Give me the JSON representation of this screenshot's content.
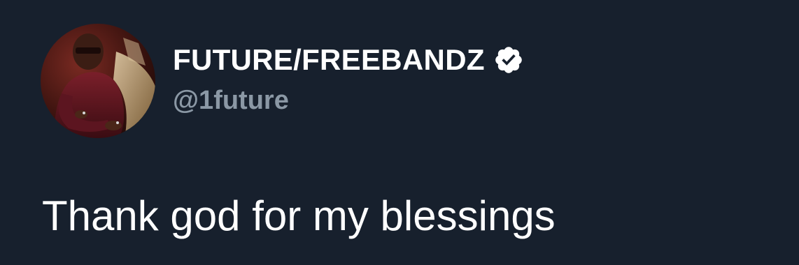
{
  "tweet": {
    "author": {
      "display_name": "FUTURE/FREEBANDZ",
      "handle": "@1future",
      "verified": true,
      "avatar_icon": "profile-photo"
    },
    "text": "Thank god for my blessings"
  },
  "colors": {
    "background": "#17202d",
    "name": "#ffffff",
    "handle": "#8b98a5",
    "text": "#ffffff",
    "verified_badge": "#ffffff"
  }
}
